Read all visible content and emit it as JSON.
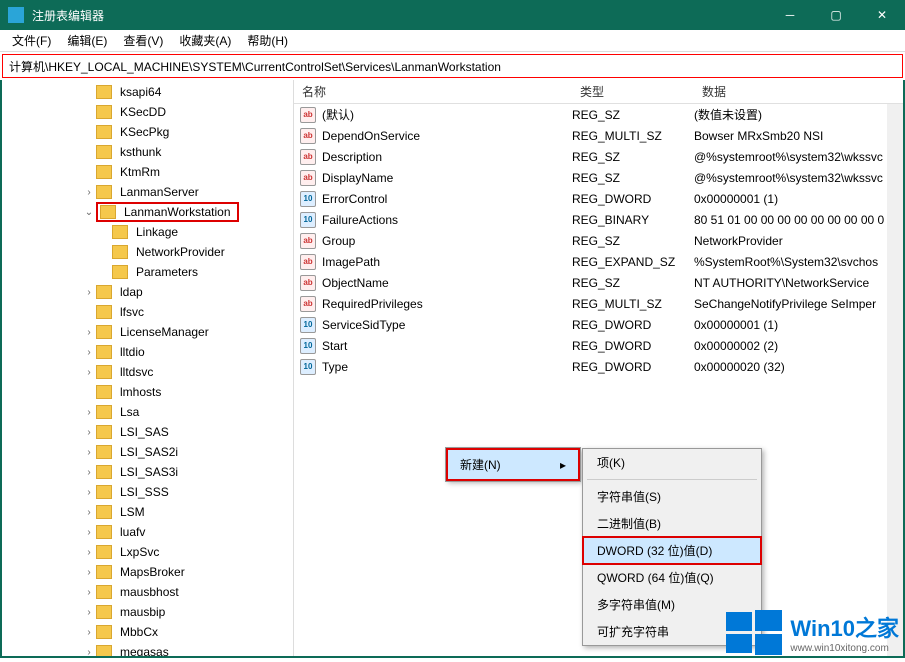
{
  "window": {
    "title": "注册表编辑器"
  },
  "menu": {
    "file": "文件(F)",
    "edit": "编辑(E)",
    "view": "查看(V)",
    "favorites": "收藏夹(A)",
    "help": "帮助(H)"
  },
  "address": "计算机\\HKEY_LOCAL_MACHINE\\SYSTEM\\CurrentControlSet\\Services\\LanmanWorkstation",
  "tree": [
    {
      "indent": 5,
      "caret": "none",
      "label": "ksapi64"
    },
    {
      "indent": 5,
      "caret": "none",
      "label": "KSecDD"
    },
    {
      "indent": 5,
      "caret": "none",
      "label": "KSecPkg"
    },
    {
      "indent": 5,
      "caret": "none",
      "label": "ksthunk"
    },
    {
      "indent": 5,
      "caret": "none",
      "label": "KtmRm"
    },
    {
      "indent": 5,
      "caret": "closed",
      "label": "LanmanServer"
    },
    {
      "indent": 5,
      "caret": "open",
      "label": "LanmanWorkstation",
      "selected": true
    },
    {
      "indent": 6,
      "caret": "none",
      "label": "Linkage"
    },
    {
      "indent": 6,
      "caret": "none",
      "label": "NetworkProvider"
    },
    {
      "indent": 6,
      "caret": "none",
      "label": "Parameters"
    },
    {
      "indent": 5,
      "caret": "closed",
      "label": "ldap"
    },
    {
      "indent": 5,
      "caret": "none",
      "label": "lfsvc"
    },
    {
      "indent": 5,
      "caret": "closed",
      "label": "LicenseManager"
    },
    {
      "indent": 5,
      "caret": "closed",
      "label": "lltdio"
    },
    {
      "indent": 5,
      "caret": "closed",
      "label": "lltdsvc"
    },
    {
      "indent": 5,
      "caret": "none",
      "label": "lmhosts"
    },
    {
      "indent": 5,
      "caret": "closed",
      "label": "Lsa"
    },
    {
      "indent": 5,
      "caret": "closed",
      "label": "LSI_SAS"
    },
    {
      "indent": 5,
      "caret": "closed",
      "label": "LSI_SAS2i"
    },
    {
      "indent": 5,
      "caret": "closed",
      "label": "LSI_SAS3i"
    },
    {
      "indent": 5,
      "caret": "closed",
      "label": "LSI_SSS"
    },
    {
      "indent": 5,
      "caret": "closed",
      "label": "LSM"
    },
    {
      "indent": 5,
      "caret": "closed",
      "label": "luafv"
    },
    {
      "indent": 5,
      "caret": "closed",
      "label": "LxpSvc"
    },
    {
      "indent": 5,
      "caret": "closed",
      "label": "MapsBroker"
    },
    {
      "indent": 5,
      "caret": "closed",
      "label": "mausbhost"
    },
    {
      "indent": 5,
      "caret": "closed",
      "label": "mausbip"
    },
    {
      "indent": 5,
      "caret": "closed",
      "label": "MbbCx"
    },
    {
      "indent": 5,
      "caret": "closed",
      "label": "megasas"
    }
  ],
  "columns": {
    "name": "名称",
    "type": "类型",
    "data": "数据"
  },
  "values": [
    {
      "ic": "str",
      "name": "(默认)",
      "type": "REG_SZ",
      "data": "(数值未设置)"
    },
    {
      "ic": "str",
      "name": "DependOnService",
      "type": "REG_MULTI_SZ",
      "data": "Bowser MRxSmb20 NSI"
    },
    {
      "ic": "str",
      "name": "Description",
      "type": "REG_SZ",
      "data": "@%systemroot%\\system32\\wkssvc"
    },
    {
      "ic": "str",
      "name": "DisplayName",
      "type": "REG_SZ",
      "data": "@%systemroot%\\system32\\wkssvc"
    },
    {
      "ic": "bin",
      "name": "ErrorControl",
      "type": "REG_DWORD",
      "data": "0x00000001 (1)"
    },
    {
      "ic": "bin",
      "name": "FailureActions",
      "type": "REG_BINARY",
      "data": "80 51 01 00 00 00 00 00 00 00 00 0"
    },
    {
      "ic": "str",
      "name": "Group",
      "type": "REG_SZ",
      "data": "NetworkProvider"
    },
    {
      "ic": "str",
      "name": "ImagePath",
      "type": "REG_EXPAND_SZ",
      "data": "%SystemRoot%\\System32\\svchos"
    },
    {
      "ic": "str",
      "name": "ObjectName",
      "type": "REG_SZ",
      "data": "NT AUTHORITY\\NetworkService"
    },
    {
      "ic": "str",
      "name": "RequiredPrivileges",
      "type": "REG_MULTI_SZ",
      "data": "SeChangeNotifyPrivilege SeImper"
    },
    {
      "ic": "bin",
      "name": "ServiceSidType",
      "type": "REG_DWORD",
      "data": "0x00000001 (1)"
    },
    {
      "ic": "bin",
      "name": "Start",
      "type": "REG_DWORD",
      "data": "0x00000002 (2)"
    },
    {
      "ic": "bin",
      "name": "Type",
      "type": "REG_DWORD",
      "data": "0x00000020 (32)"
    }
  ],
  "context1": {
    "new": "新建(N)"
  },
  "context2": {
    "key": "项(K)",
    "string": "字符串值(S)",
    "binary": "二进制值(B)",
    "dword": "DWORD (32 位)值(D)",
    "qword": "QWORD (64 位)值(Q)",
    "multi": "多字符串值(M)",
    "expand": "可扩充字符串"
  },
  "watermark": {
    "line1": "Win10之家",
    "line2": "www.win10xitong.com"
  }
}
